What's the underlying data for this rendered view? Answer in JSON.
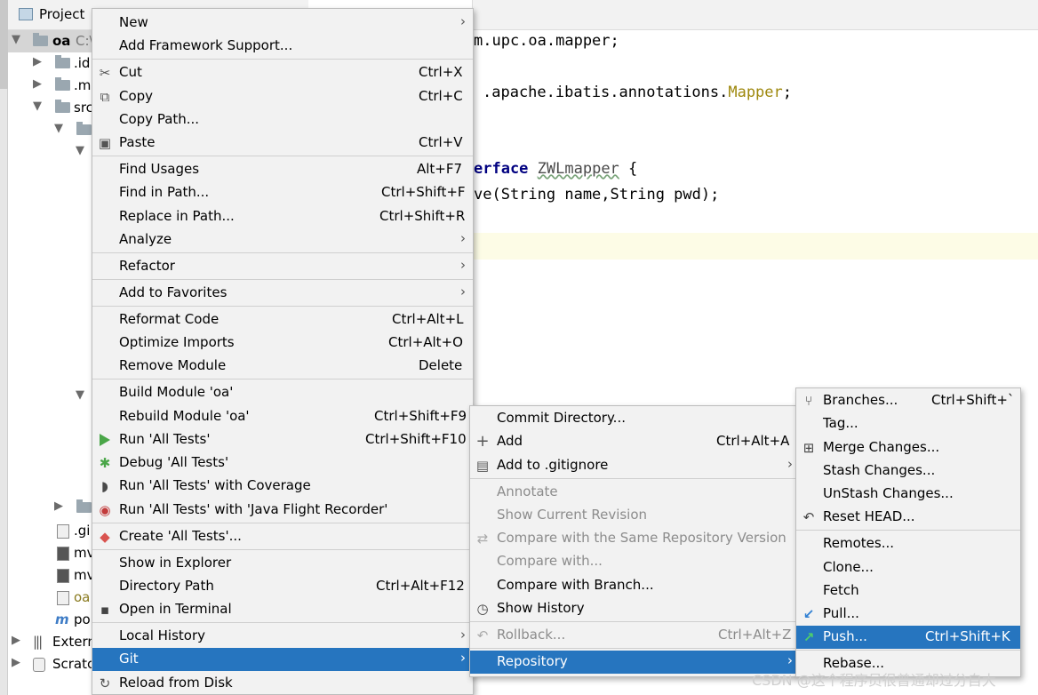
{
  "project_panel": {
    "title": "Project",
    "rows": [
      {
        "label": "oa",
        "suffix": "C:\\"
      },
      {
        "label": ".id"
      },
      {
        "label": ".m"
      },
      {
        "label": "src"
      },
      {
        "label": ".gi"
      },
      {
        "label": "mv"
      },
      {
        "label": "mv"
      },
      {
        "label": "oa"
      },
      {
        "label": "po"
      },
      {
        "label": "Extern"
      },
      {
        "label": "Scratc"
      }
    ]
  },
  "editor": {
    "lines": {
      "l1": "m.upc.oa.mapper;",
      "l2a": ".apache.ibatis.annotations.",
      "l2b": "Mapper",
      "l2c": ";",
      "l3a": "erface",
      "l3b": "ZWLmapper",
      "l3c": " {",
      "l4": "ve(String name,String pwd);"
    }
  },
  "context_menu": {
    "items": [
      {
        "label": "New"
      },
      {
        "label": "Add Framework Support..."
      },
      {
        "label": "Cut",
        "shortcut": "Ctrl+X"
      },
      {
        "label": "Copy",
        "shortcut": "Ctrl+C"
      },
      {
        "label": "Copy Path..."
      },
      {
        "label": "Paste",
        "shortcut": "Ctrl+V"
      },
      {
        "label": "Find Usages",
        "shortcut": "Alt+F7"
      },
      {
        "label": "Find in Path...",
        "shortcut": "Ctrl+Shift+F"
      },
      {
        "label": "Replace in Path...",
        "shortcut": "Ctrl+Shift+R"
      },
      {
        "label": "Analyze"
      },
      {
        "label": "Refactor"
      },
      {
        "label": "Add to Favorites"
      },
      {
        "label": "Reformat Code",
        "shortcut": "Ctrl+Alt+L"
      },
      {
        "label": "Optimize Imports",
        "shortcut": "Ctrl+Alt+O"
      },
      {
        "label": "Remove Module",
        "shortcut": "Delete"
      },
      {
        "label": "Build Module 'oa'"
      },
      {
        "label": "Rebuild Module 'oa'",
        "shortcut": "Ctrl+Shift+F9"
      },
      {
        "label": "Run 'All Tests'",
        "shortcut": "Ctrl+Shift+F10"
      },
      {
        "label": "Debug 'All Tests'"
      },
      {
        "label": "Run 'All Tests' with Coverage"
      },
      {
        "label": "Run 'All Tests' with 'Java Flight Recorder'"
      },
      {
        "label": "Create 'All Tests'..."
      },
      {
        "label": "Show in Explorer"
      },
      {
        "label": "Directory Path",
        "shortcut": "Ctrl+Alt+F12"
      },
      {
        "label": "Open in Terminal"
      },
      {
        "label": "Local History"
      },
      {
        "label": "Git"
      },
      {
        "label": "Reload from Disk"
      }
    ]
  },
  "git_menu": {
    "items": [
      {
        "label": "Commit Directory..."
      },
      {
        "label": "Add",
        "shortcut": "Ctrl+Alt+A"
      },
      {
        "label": "Add to .gitignore"
      },
      {
        "label": "Annotate"
      },
      {
        "label": "Show Current Revision"
      },
      {
        "label": "Compare with the Same Repository Version"
      },
      {
        "label": "Compare with..."
      },
      {
        "label": "Compare with Branch..."
      },
      {
        "label": "Show History"
      },
      {
        "label": "Rollback...",
        "shortcut": "Ctrl+Alt+Z"
      },
      {
        "label": "Repository"
      }
    ]
  },
  "repo_menu": {
    "items": [
      {
        "label": "Branches...",
        "shortcut": "Ctrl+Shift+`"
      },
      {
        "label": "Tag..."
      },
      {
        "label": "Merge Changes..."
      },
      {
        "label": "Stash Changes..."
      },
      {
        "label": "UnStash Changes..."
      },
      {
        "label": "Reset HEAD..."
      },
      {
        "label": "Remotes..."
      },
      {
        "label": "Clone..."
      },
      {
        "label": "Fetch"
      },
      {
        "label": "Pull..."
      },
      {
        "label": "Push...",
        "shortcut": "Ctrl+Shift+K"
      },
      {
        "label": "Rebase..."
      }
    ]
  },
  "watermark": "CSDN @这个程序员很普通却过分自大",
  "colors": {
    "highlight": "#2675bf",
    "menu_bg": "#f2f2f2"
  }
}
